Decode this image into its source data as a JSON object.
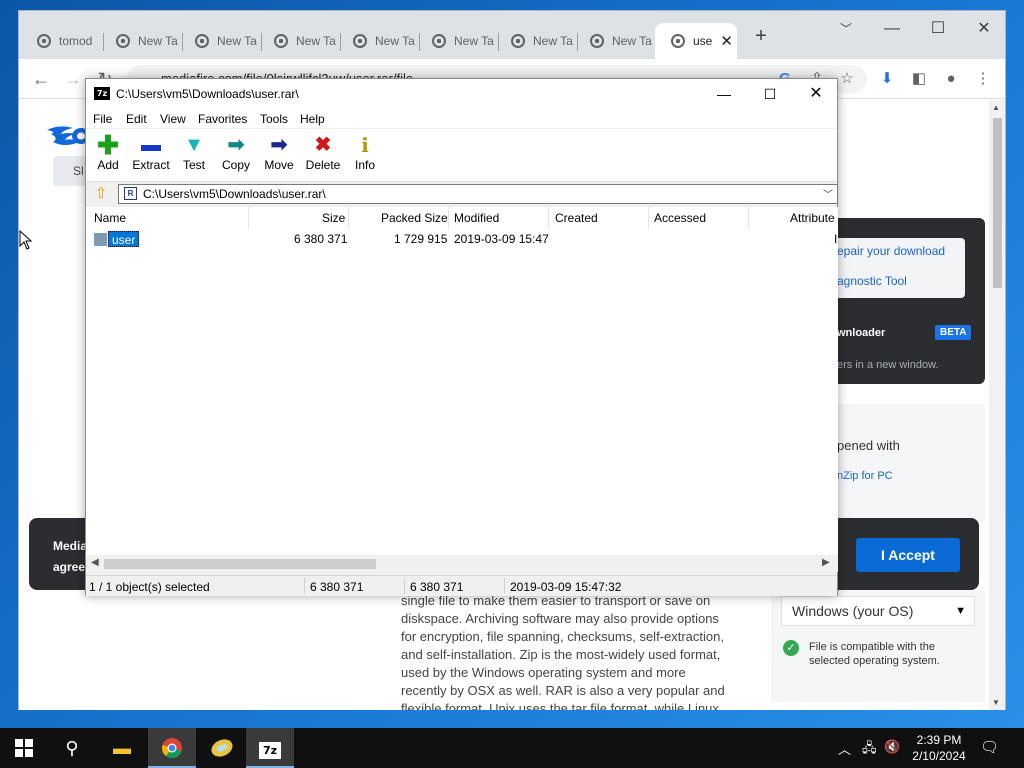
{
  "browser": {
    "tabs": [
      {
        "label": "tomod"
      },
      {
        "label": "New Ta"
      },
      {
        "label": "New Ta"
      },
      {
        "label": "New Ta"
      },
      {
        "label": "New Ta"
      },
      {
        "label": "New Ta"
      },
      {
        "label": "New Ta"
      },
      {
        "label": "New Ta"
      },
      {
        "label": "use",
        "active": true
      }
    ],
    "new_tab_symbol": "+",
    "url": "mediafire.com/file/0lsirwllifcl3uw/user.rar/file",
    "window_controls": {
      "minimize": "—",
      "maximize": "☐",
      "close": "✕"
    }
  },
  "page": {
    "side_button": "Sl",
    "repair_link": "epair your download",
    "diagnostic_link": "agnostic Tool",
    "downloader_label": "wnloader",
    "beta_badge": "BETA",
    "new_window_text": "ers in a new window.",
    "opened_with": "pened with",
    "winzip_link": "nZip for PC",
    "cookie_text_1": "MediaF",
    "cookie_text_2": "agree t",
    "accept_button": "I Accept",
    "os_select_value": "Windows (your OS)",
    "compat_text": "File is compatible with the selected operating system.",
    "article_lines": [
      "single file to make them easier to transport or save on",
      "diskspace. Archiving software may also provide options",
      "for encryption, file spanning, checksums, self-extraction,",
      "and self-installation. Zip is the most-widely used format,",
      "used by the Windows operating system and more",
      "recently by OSX as well. RAR is also a very popular and",
      "flexible format. Unix uses the tar file format, while Linux"
    ]
  },
  "sevenzip": {
    "title": "C:\\Users\\vm5\\Downloads\\user.rar\\",
    "logo": "7z",
    "menu": [
      "File",
      "Edit",
      "View",
      "Favorites",
      "Tools",
      "Help"
    ],
    "tools": [
      {
        "label": "Add",
        "icon": "+",
        "color": "#1aa11a"
      },
      {
        "label": "Extract",
        "icon": "▬",
        "color": "#1836c8"
      },
      {
        "label": "Test",
        "icon": "▼",
        "color": "#19b3b8"
      },
      {
        "label": "Copy",
        "icon": "➡",
        "color": "#138a8a"
      },
      {
        "label": "Move",
        "icon": "➡",
        "color": "#1a2a8c"
      },
      {
        "label": "Delete",
        "icon": "✖",
        "color": "#d01818"
      },
      {
        "label": "Info",
        "icon": "i",
        "color": "#b09a00"
      }
    ],
    "address": "C:\\Users\\vm5\\Downloads\\user.rar\\",
    "columns": [
      "Name",
      "Size",
      "Packed Size",
      "Modified",
      "Created",
      "Accessed",
      "Attribute"
    ],
    "rows": [
      {
        "name": "user",
        "size": "6 380 371",
        "packed": "1 729 915",
        "modified": "2019-03-09 15:47",
        "created": "",
        "accessed": "",
        "attributes": "I"
      }
    ],
    "status": {
      "selection": "1 / 1 object(s) selected",
      "size": "6 380 371",
      "packed": "6 380 371",
      "modified": "2019-03-09 15:47:32"
    }
  },
  "taskbar": {
    "clock_time": "2:39 PM",
    "clock_date": "2/10/2024",
    "sevenzip_label": "7z"
  }
}
